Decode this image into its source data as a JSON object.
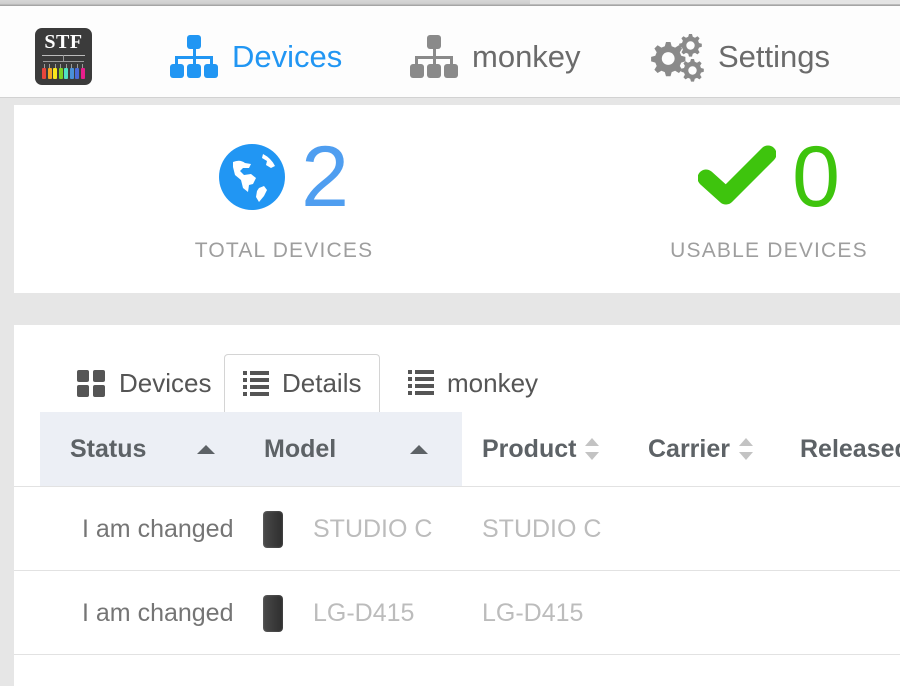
{
  "window": {
    "chrome_bar": "window-title-bar"
  },
  "nav": {
    "logo": {
      "text": "STF",
      "icon": "stf-logo-icon",
      "background": "#3b3b3b",
      "device_colors": [
        "#e8453c",
        "#f5a623",
        "#f8e71c",
        "#7ed321",
        "#50e3c2",
        "#4a90d9",
        "#4a6ad9",
        "#e91e8c"
      ]
    },
    "items": [
      {
        "label": "Devices",
        "icon": "sitemap-icon",
        "active": true,
        "color": "#2196f3"
      },
      {
        "label": "monkey",
        "icon": "sitemap-icon",
        "active": false,
        "color": "#6b6b6b"
      },
      {
        "label": "Settings",
        "icon": "gears-icon",
        "active": false,
        "color": "#6b6b6b"
      }
    ]
  },
  "stats": [
    {
      "icon": "globe-icon",
      "icon_color": "#2196f3",
      "value": "2",
      "value_color": "#4f9ef0",
      "label": "TOTAL DEVICES"
    },
    {
      "icon": "check-icon",
      "icon_color": "#3ec40d",
      "value": "0",
      "value_color": "#3ec40d",
      "label": "USABLE DEVICES"
    }
  ],
  "tabs": [
    {
      "label": "Devices",
      "icon": "grid-icon",
      "active": false
    },
    {
      "label": "Details",
      "icon": "list-icon",
      "active": true
    },
    {
      "label": "monkey",
      "icon": "list-icon",
      "active": false
    }
  ],
  "table": {
    "columns": [
      {
        "label": "Status",
        "sort": "asc",
        "highlighted": true
      },
      {
        "label": "Model",
        "sort": "asc",
        "highlighted": true
      },
      {
        "label": "Product",
        "sort": "none",
        "highlighted": false
      },
      {
        "label": "Carrier",
        "sort": "none",
        "highlighted": false
      },
      {
        "label": "Released",
        "sort": "none",
        "highlighted": false
      }
    ],
    "rows": [
      {
        "status": "I am changed",
        "device_icon": "phone-icon",
        "model": "STUDIO C",
        "product": "STUDIO C"
      },
      {
        "status": "I am changed",
        "device_icon": "phone-icon",
        "model": "LG-D415",
        "product": "LG-D415"
      }
    ]
  }
}
